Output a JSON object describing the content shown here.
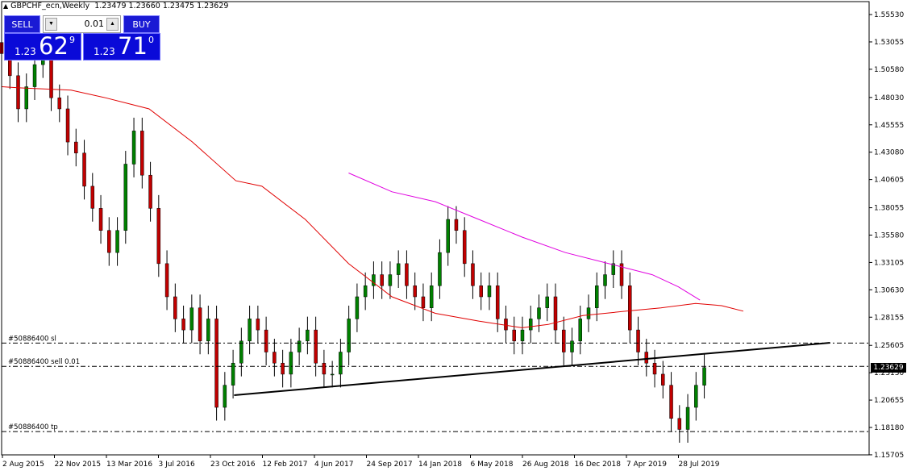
{
  "header": {
    "symbol_tf": "GBPCHF_ecn,Weekly",
    "ohlc": "1.23479 1.23660 1.23475 1.23629"
  },
  "trade_panel": {
    "sell_label": "SELL",
    "buy_label": "BUY",
    "lot_value": "0.01",
    "sell_quote": {
      "small": "1.23",
      "big": "62",
      "sup": "9"
    },
    "buy_quote": {
      "small": "1.23",
      "big": "71",
      "sup": "0"
    }
  },
  "price_axis": {
    "labels": [
      "1.55530",
      "1.53055",
      "1.50580",
      "1.48030",
      "1.45555",
      "1.43080",
      "1.40605",
      "1.38055",
      "1.35580",
      "1.33105",
      "1.30630",
      "1.28155",
      "1.25605",
      "1.23130",
      "1.20655",
      "1.18180",
      "1.15705"
    ],
    "current_price": "1.23629"
  },
  "time_axis": {
    "labels": [
      "2 Aug 2015",
      "22 Nov 2015",
      "13 Mar 2016",
      "3 Jul 2016",
      "23 Oct 2016",
      "12 Feb 2017",
      "4 Jun 2017",
      "24 Sep 2017",
      "14 Jan 2018",
      "6 May 2018",
      "26 Aug 2018",
      "16 Dec 2018",
      "7 Apr 2019",
      "28 Jul 2019"
    ]
  },
  "order_lines": [
    {
      "label": "#50886400 sl",
      "price": 1.2581
    },
    {
      "label": "#50886400 sell 0.01",
      "price": 1.2371
    },
    {
      "label": "#50886400 tp",
      "price": 1.1781
    }
  ],
  "colors": {
    "bull": "#008000",
    "bear": "#c00000",
    "ma_slow": "#e00000",
    "ma_fast": "#e000e0",
    "panel_blue": "#1a1ad4"
  },
  "chart_data": {
    "type": "candlestick",
    "ylim": [
      1.157,
      1.567
    ],
    "ma_red": [
      [
        0.0,
        1.49
      ],
      [
        0.02,
        1.489
      ],
      [
        0.08,
        1.487
      ],
      [
        0.12,
        1.48
      ],
      [
        0.17,
        1.47
      ],
      [
        0.22,
        1.44
      ],
      [
        0.27,
        1.405
      ],
      [
        0.3,
        1.4
      ],
      [
        0.35,
        1.37
      ],
      [
        0.4,
        1.33
      ],
      [
        0.45,
        1.3
      ],
      [
        0.5,
        1.285
      ],
      [
        0.55,
        1.278
      ],
      [
        0.6,
        1.272
      ],
      [
        0.63,
        1.275
      ],
      [
        0.67,
        1.283
      ],
      [
        0.72,
        1.287
      ],
      [
        0.76,
        1.29
      ],
      [
        0.8,
        1.294
      ],
      [
        0.83,
        1.292
      ],
      [
        0.855,
        1.287
      ]
    ],
    "ma_magenta": [
      [
        0.4,
        1.412
      ],
      [
        0.45,
        1.395
      ],
      [
        0.5,
        1.386
      ],
      [
        0.55,
        1.37
      ],
      [
        0.6,
        1.354
      ],
      [
        0.65,
        1.34
      ],
      [
        0.7,
        1.33
      ],
      [
        0.75,
        1.32
      ],
      [
        0.78,
        1.309
      ],
      [
        0.805,
        1.297
      ]
    ],
    "trendline": [
      [
        0.268,
        1.211
      ],
      [
        0.955,
        1.2584
      ]
    ],
    "candles_close": [
      1.52,
      1.5,
      1.47,
      1.49,
      1.51,
      1.52,
      1.48,
      1.47,
      1.44,
      1.43,
      1.4,
      1.38,
      1.36,
      1.34,
      1.36,
      1.42,
      1.45,
      1.41,
      1.38,
      1.33,
      1.3,
      1.28,
      1.27,
      1.29,
      1.26,
      1.28,
      1.2,
      1.22,
      1.24,
      1.26,
      1.28,
      1.27,
      1.25,
      1.24,
      1.23,
      1.25,
      1.26,
      1.27,
      1.24,
      1.23,
      1.23,
      1.25,
      1.28,
      1.3,
      1.31,
      1.32,
      1.31,
      1.32,
      1.33,
      1.31,
      1.3,
      1.29,
      1.31,
      1.34,
      1.37,
      1.36,
      1.33,
      1.31,
      1.3,
      1.31,
      1.28,
      1.27,
      1.26,
      1.27,
      1.28,
      1.29,
      1.3,
      1.27,
      1.25,
      1.26,
      1.28,
      1.29,
      1.31,
      1.32,
      1.33,
      1.31,
      1.27,
      1.25,
      1.24,
      1.23,
      1.22,
      1.19,
      1.18,
      1.2,
      1.22,
      1.236
    ]
  }
}
